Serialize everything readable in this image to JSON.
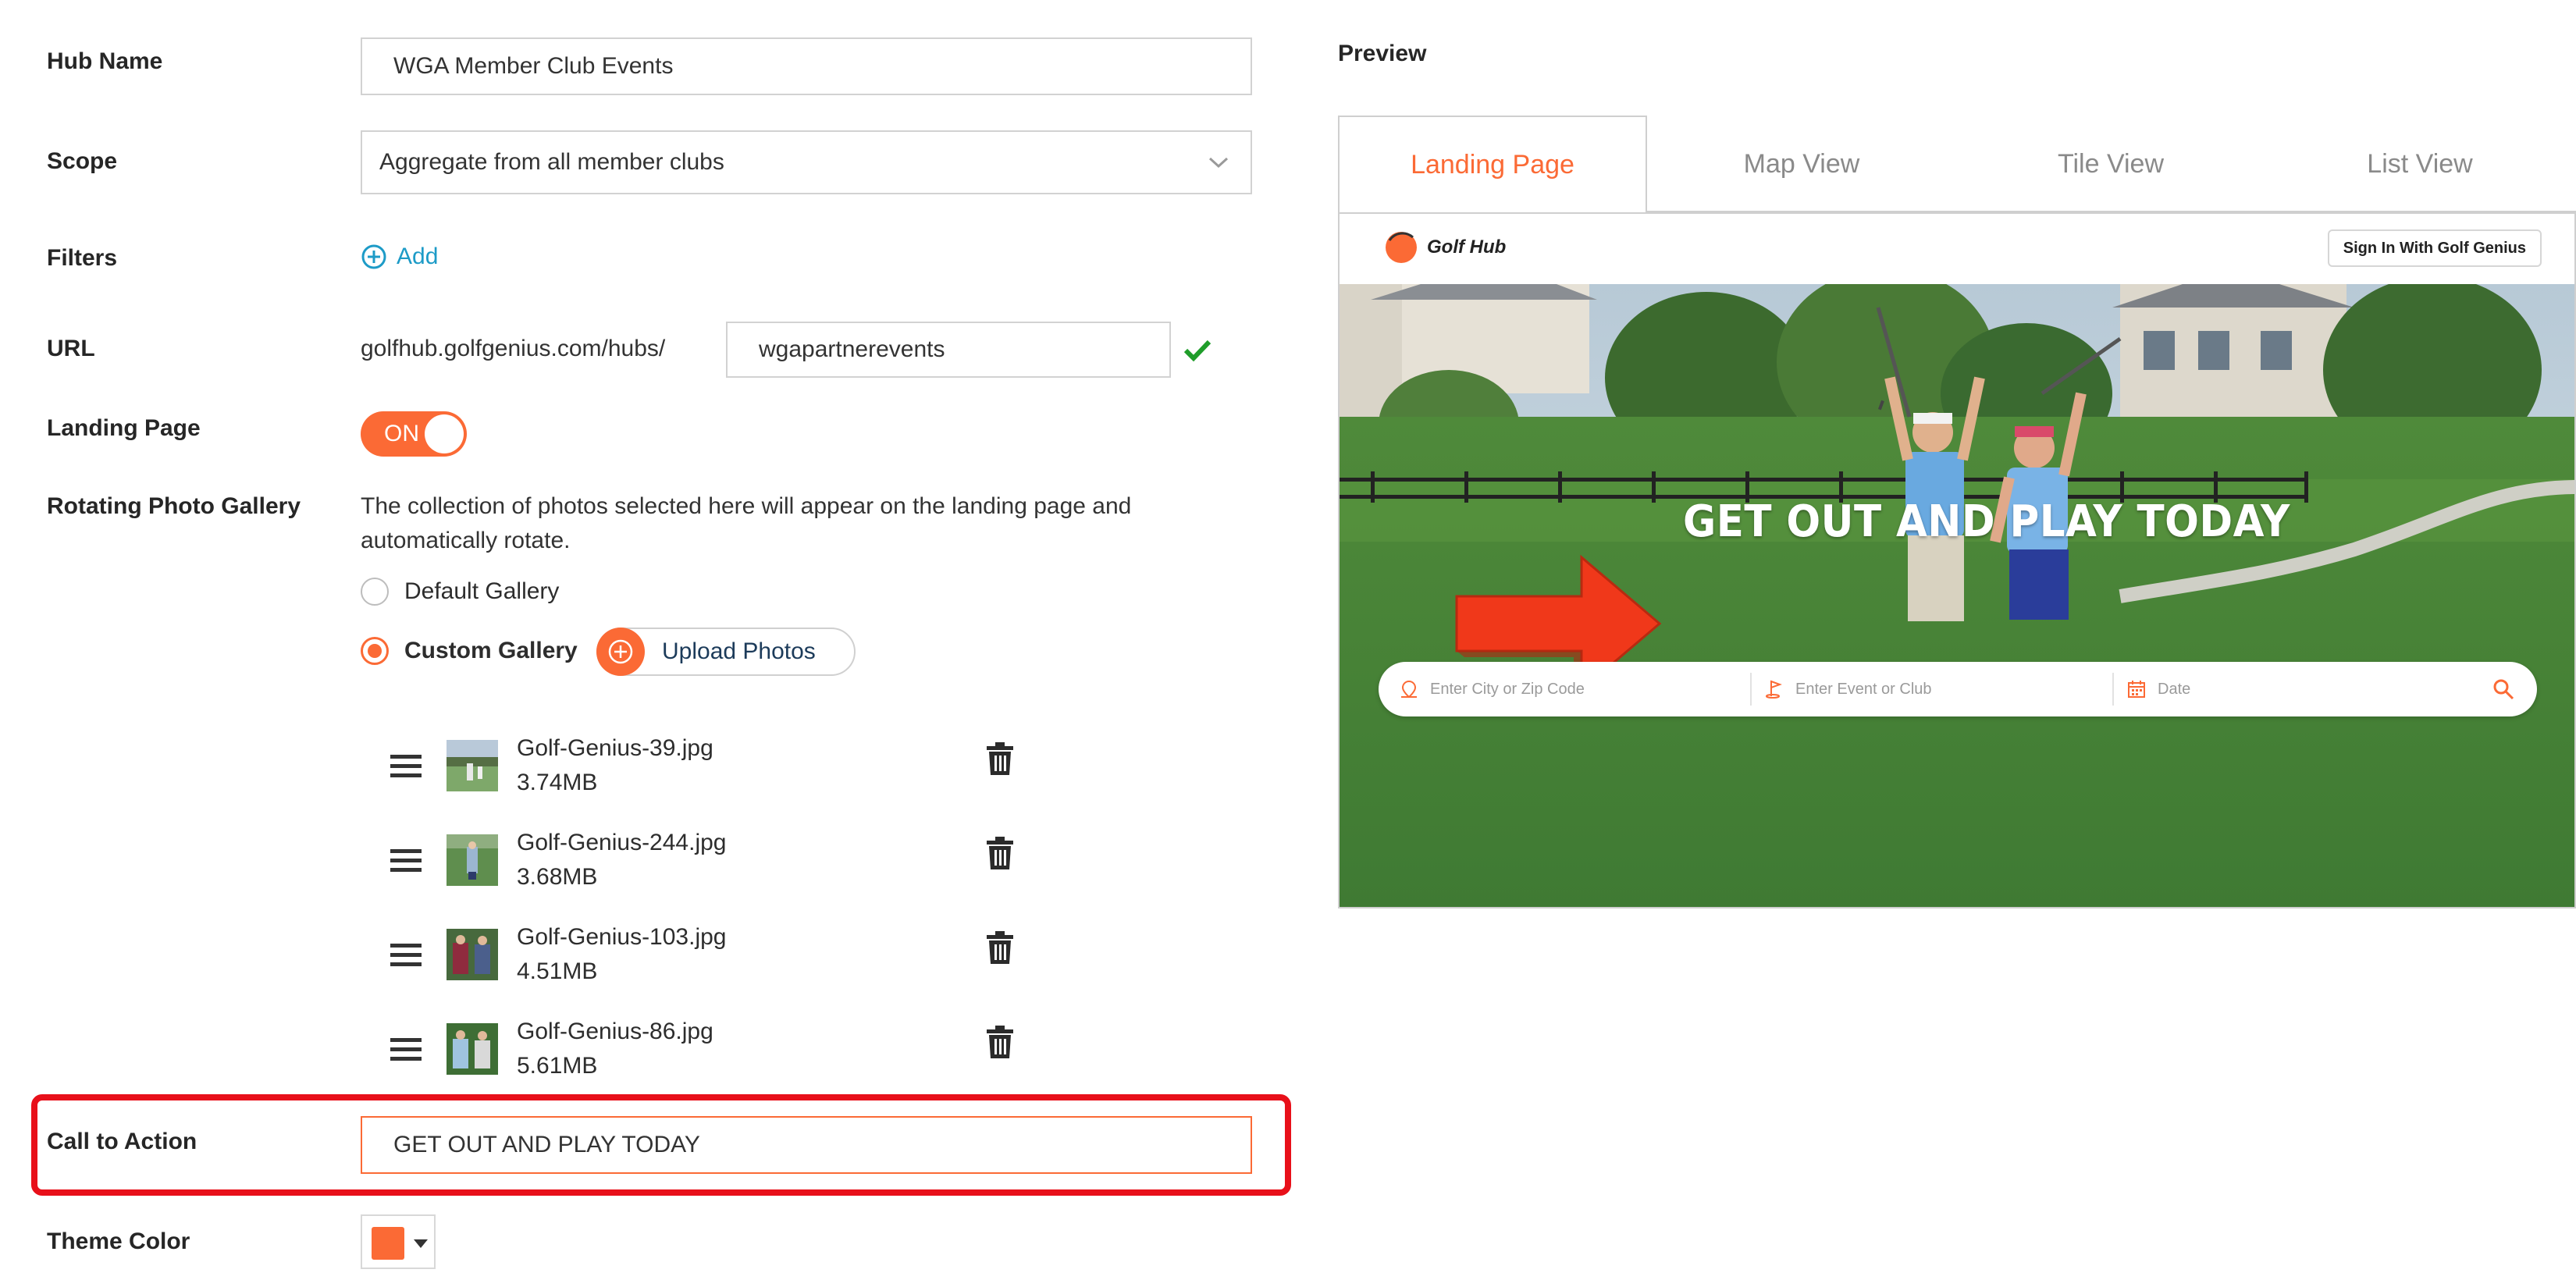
{
  "form": {
    "hub_name_label": "Hub Name",
    "hub_name_value": "WGA Member Club Events",
    "scope_label": "Scope",
    "scope_value": "Aggregate from all member clubs",
    "filters_label": "Filters",
    "filters_add": "Add",
    "url_label": "URL",
    "url_prefix": "golfhub.golfgenius.com/hubs/",
    "url_slug": "wgapartnerevents",
    "landing_page_label": "Landing Page",
    "landing_page_toggle": "ON",
    "gallery_label": "Rotating Photo Gallery",
    "gallery_desc_1": "The collection of photos selected here will appear on the landing page and",
    "gallery_desc_2": "automatically rotate.",
    "gallery_default": "Default Gallery",
    "gallery_custom": "Custom Gallery",
    "upload_label": "Upload Photos",
    "photos": [
      {
        "name": "Golf-Genius-39.jpg",
        "size": "3.74MB"
      },
      {
        "name": "Golf-Genius-244.jpg",
        "size": "3.68MB"
      },
      {
        "name": "Golf-Genius-103.jpg",
        "size": "4.51MB"
      },
      {
        "name": "Golf-Genius-86.jpg",
        "size": "5.61MB"
      }
    ],
    "cta_label": "Call to Action",
    "cta_value": "GET OUT AND PLAY TODAY",
    "theme_label": "Theme Color",
    "theme_color": "#fb6a35"
  },
  "preview": {
    "title": "Preview",
    "tabs": [
      "Landing Page",
      "Map View",
      "Tile View",
      "List View"
    ],
    "active_tab": "Landing Page",
    "logo_mark": "GH",
    "logo_text": "Golf Hub",
    "signin": "Sign In With Golf Genius",
    "cta": "GET OUT AND PLAY TODAY",
    "search_city_placeholder": "Enter City or Zip Code",
    "search_event_placeholder": "Enter Event or Club",
    "search_date_placeholder": "Date"
  },
  "colors": {
    "accent": "#fb6a35",
    "link": "#1d9bc7",
    "check": "#1f9d2a",
    "highlight": "#e8101a"
  }
}
